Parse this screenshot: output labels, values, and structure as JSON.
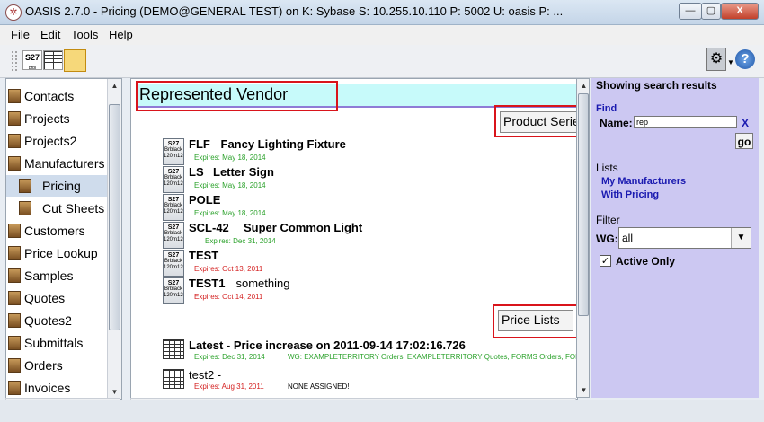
{
  "window": {
    "title": "OASIS 2.7.0 - Pricing (DEMO@GENERAL TEST) on K: Sybase  S: 10.255.10.110  P: 5002  U: oasis  P: ...",
    "minimize": "—",
    "maximize": "▢",
    "close": "X"
  },
  "menu": [
    "File",
    "Edit",
    "Tools",
    "Help"
  ],
  "toolbar": {
    "s27_label": "S27",
    "s27_sub": "brbl"
  },
  "sidebar": {
    "items": [
      {
        "label": "Contacts",
        "indent": false,
        "selected": false
      },
      {
        "label": "Projects",
        "indent": false,
        "selected": false
      },
      {
        "label": "Projects2",
        "indent": false,
        "selected": false
      },
      {
        "label": "Manufacturers",
        "indent": false,
        "selected": false
      },
      {
        "label": "Pricing",
        "indent": true,
        "selected": true
      },
      {
        "label": "Cut Sheets",
        "indent": true,
        "selected": false
      },
      {
        "label": "Customers",
        "indent": false,
        "selected": false
      },
      {
        "label": "Price Lookup",
        "indent": false,
        "selected": false
      },
      {
        "label": "Samples",
        "indent": false,
        "selected": false
      },
      {
        "label": "Quotes",
        "indent": false,
        "selected": false
      },
      {
        "label": "Quotes2",
        "indent": false,
        "selected": false
      },
      {
        "label": "Submittals",
        "indent": false,
        "selected": false
      },
      {
        "label": "Orders",
        "indent": false,
        "selected": false
      },
      {
        "label": "Invoices",
        "indent": false,
        "selected": false
      }
    ]
  },
  "main": {
    "vendor_title": "Represented Vendor",
    "product_series_btn": "Product Series",
    "price_lists_btn": "Price Lists",
    "icon_text": {
      "top": "S27",
      "mid": "Brblack",
      "bot": "120m120"
    },
    "series": [
      {
        "code": "FLF",
        "name": "Fancy Lighting Fixture",
        "expires": "Expires: May 18, 2014",
        "status": "ok"
      },
      {
        "code": "LS",
        "name": "Letter Sign",
        "expires": "Expires: May 18, 2014",
        "status": "ok"
      },
      {
        "code": "POLE",
        "name": "",
        "expires": "Expires: May 18, 2014",
        "status": "ok"
      },
      {
        "code": "SCL-42",
        "name": "Super Common Light",
        "expires": "Expires: Dec 31, 2014",
        "status": "ok"
      },
      {
        "code": "TEST",
        "name": "",
        "expires": "Expires: Oct 13, 2011",
        "status": "bad"
      },
      {
        "code": "TEST1",
        "name": "something",
        "expires": "Expires: Oct 14, 2011",
        "status": "bad"
      }
    ],
    "price_lists": [
      {
        "title": "Latest - Price increase on 2011-09-14 17:02:16.726",
        "expires": "Expires: Dec 31, 2014",
        "status": "ok",
        "note": "WG: EXAMPLETERRITORY Orders, EXAMPLETERRITORY Quotes, FORMS Orders, FORMS Q"
      },
      {
        "title": "test2 -",
        "expires": "Expires: Aug 31, 2011",
        "status": "bad",
        "note": "NONE ASSIGNED!"
      }
    ]
  },
  "right": {
    "heading": "Showing search results",
    "find_label": "Find",
    "name_label": "Name:",
    "name_value": "rep",
    "clear_label": "X",
    "go_label": "go",
    "lists_label": "Lists",
    "lists": [
      "My Manufacturers",
      "With Pricing"
    ],
    "filter_label": "Filter",
    "wg_label": "WG:",
    "wg_value": "all",
    "active_only_label": "Active Only",
    "active_only_checked": true
  },
  "colors": {
    "accent_red": "#d9141b",
    "banner": "#c7fafa",
    "panel": "#ccc8f2",
    "link": "#1a1ab0"
  }
}
